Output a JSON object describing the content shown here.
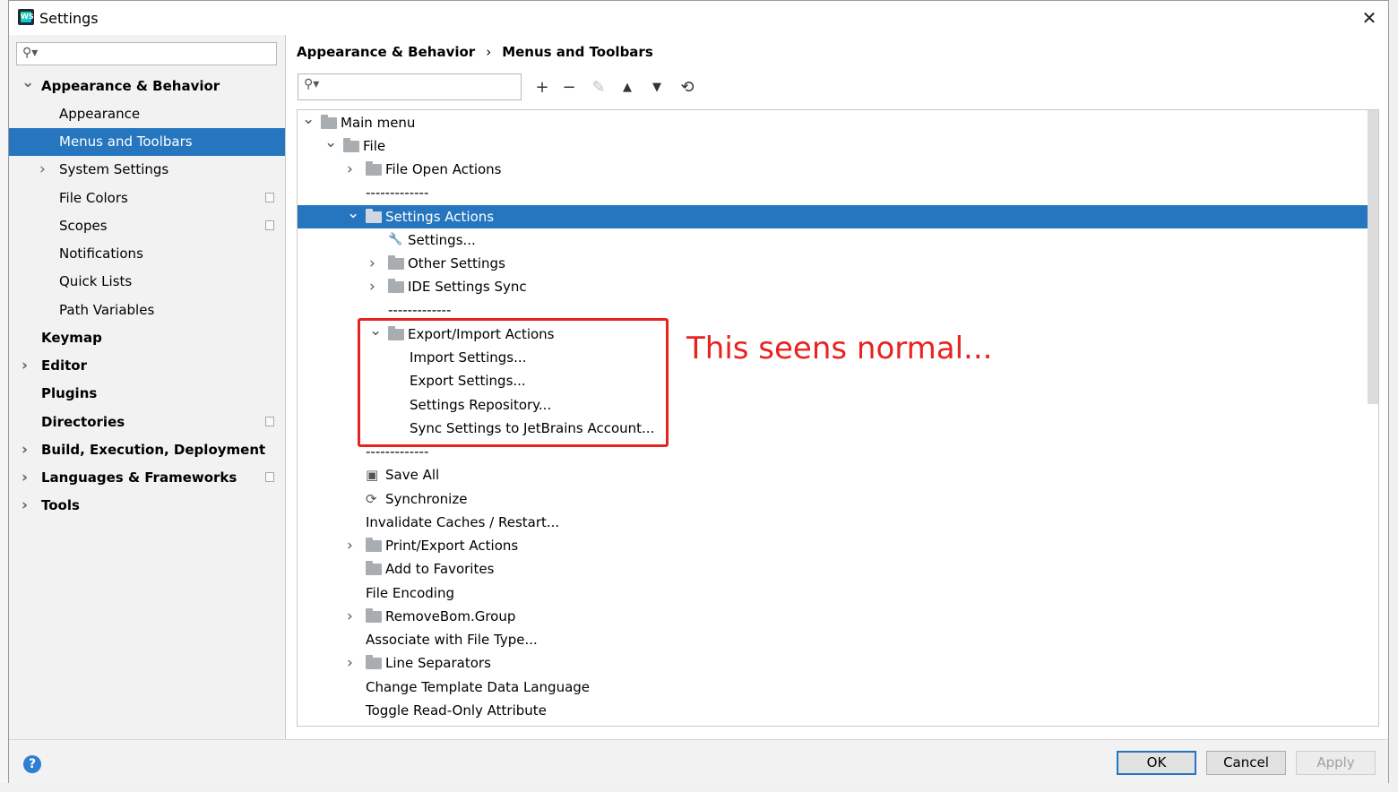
{
  "window": {
    "title": "Settings",
    "close_icon": "close-icon"
  },
  "sidebar": {
    "items": [
      {
        "label": "Appearance & Behavior",
        "bold": true,
        "arrow": "expanded"
      },
      {
        "label": "Appearance"
      },
      {
        "label": "Menus and Toolbars",
        "selected": true
      },
      {
        "label": "System Settings",
        "arrow": "collapsed"
      },
      {
        "label": "File Colors",
        "project_icon": true
      },
      {
        "label": "Scopes",
        "project_icon": true
      },
      {
        "label": "Notifications"
      },
      {
        "label": "Quick Lists"
      },
      {
        "label": "Path Variables"
      },
      {
        "label": "Keymap",
        "bold": true
      },
      {
        "label": "Editor",
        "bold": true,
        "arrow": "collapsed"
      },
      {
        "label": "Plugins",
        "bold": true
      },
      {
        "label": "Directories",
        "bold": true,
        "project_icon": true
      },
      {
        "label": "Build, Execution, Deployment",
        "bold": true,
        "arrow": "collapsed"
      },
      {
        "label": "Languages & Frameworks",
        "bold": true,
        "arrow": "collapsed",
        "project_icon": true
      },
      {
        "label": "Tools",
        "bold": true,
        "arrow": "collapsed"
      }
    ]
  },
  "breadcrumb": {
    "parent": "Appearance & Behavior",
    "separator": "›",
    "current": "Menus and Toolbars"
  },
  "toolbar": {
    "add": "+",
    "remove": "−",
    "edit": "✎",
    "move_up": "▲",
    "move_down": "▼",
    "restore": "⟲"
  },
  "tree": {
    "rows": [
      {
        "label": "Main menu",
        "arrow": "expanded",
        "icon": "folder"
      },
      {
        "label": "File",
        "arrow": "expanded",
        "icon": "folder"
      },
      {
        "label": "File Open Actions",
        "arrow": "collapsed",
        "icon": "folder"
      },
      {
        "label": "-------------"
      },
      {
        "label": "Settings Actions",
        "arrow": "expanded",
        "icon": "folder",
        "selected": true
      },
      {
        "label": "Settings...",
        "icon": "wrench"
      },
      {
        "label": "Other Settings",
        "arrow": "collapsed",
        "icon": "folder"
      },
      {
        "label": "IDE Settings Sync",
        "arrow": "collapsed",
        "icon": "folder"
      },
      {
        "label": "-------------"
      },
      {
        "label": "Export/Import Actions",
        "arrow": "expanded",
        "icon": "folder"
      },
      {
        "label": "Import Settings..."
      },
      {
        "label": "Export Settings..."
      },
      {
        "label": "Settings Repository..."
      },
      {
        "label": "Sync Settings to JetBrains Account..."
      },
      {
        "label": "-------------"
      },
      {
        "label": "Save All",
        "icon": "save"
      },
      {
        "label": "Synchronize",
        "icon": "sync"
      },
      {
        "label": "Invalidate Caches / Restart..."
      },
      {
        "label": "Print/Export Actions",
        "arrow": "collapsed",
        "icon": "folder"
      },
      {
        "label": "Add to Favorites",
        "icon": "folder"
      },
      {
        "label": "File Encoding"
      },
      {
        "label": "RemoveBom.Group",
        "arrow": "collapsed",
        "icon": "folder"
      },
      {
        "label": "Associate with File Type..."
      },
      {
        "label": "Line Separators",
        "arrow": "collapsed",
        "icon": "folder"
      },
      {
        "label": "Change Template Data Language"
      },
      {
        "label": "Toggle Read-Only Attribute"
      }
    ]
  },
  "annotation": {
    "text": "This seens normal...",
    "color": "#e8231f"
  },
  "footer": {
    "help": "?",
    "ok": "OK",
    "cancel": "Cancel",
    "apply": "Apply"
  },
  "colors": {
    "selection": "#2675bf",
    "sidebar_bg": "#f2f2f2",
    "annotation": "#e8231f"
  }
}
